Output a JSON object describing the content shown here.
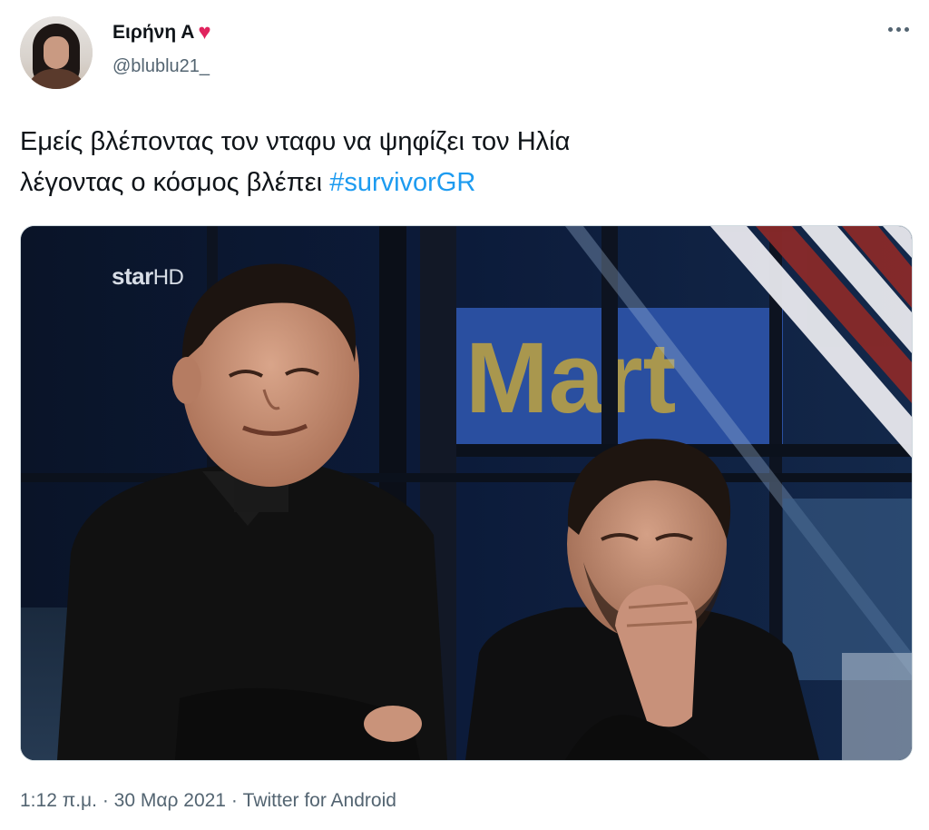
{
  "user": {
    "display_name": "Ειρήνη Α",
    "handle": "@blublu21_",
    "badge_icon": "heart-icon"
  },
  "tweet": {
    "line1": "Εμείς βλέποντας τον νταφυ να ψηφίζει τον Ηλία",
    "line2": "λέγοντας ο κόσμος βλέπει",
    "hashtag": "#survivorGR"
  },
  "media": {
    "watermark_main": "star",
    "watermark_suffix": "HD",
    "sign_text": "Mart"
  },
  "meta": {
    "time": "1:12 π.μ.",
    "date": "30 Μαρ 2021",
    "source": "Twitter for Android",
    "separator": "·"
  },
  "colors": {
    "accent": "#1d9bf0",
    "heart": "#e0245e",
    "secondary_text": "#536471"
  }
}
